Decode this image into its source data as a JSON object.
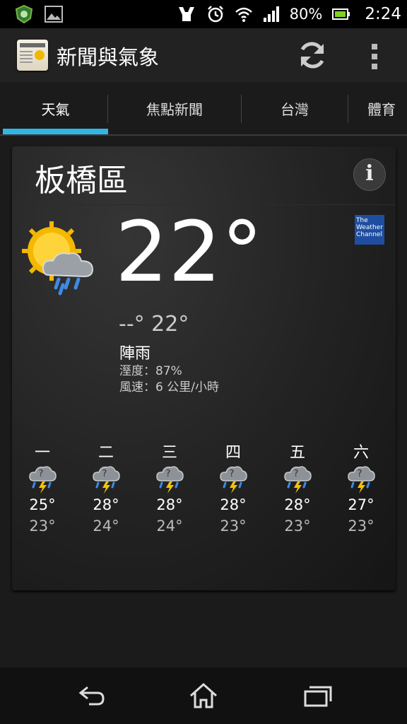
{
  "status_bar": {
    "battery": "80%",
    "time": "2:24",
    "icons": [
      "shield-icon",
      "image-icon",
      "accessory-icon",
      "alarm-icon",
      "wifi-icon",
      "signal-icon",
      "battery-icon"
    ]
  },
  "action_bar": {
    "title": "新聞與氣象",
    "icons": [
      "app-newspaper-icon",
      "refresh-icon",
      "overflow-menu-icon"
    ]
  },
  "tabs": [
    {
      "label": "天氣",
      "selected": true
    },
    {
      "label": "焦點新聞",
      "selected": false
    },
    {
      "label": "台灣",
      "selected": false
    },
    {
      "label": "體育",
      "selected": false
    }
  ],
  "colors": {
    "accent": "#33b5e5",
    "background": "#1b1b1b"
  },
  "weather": {
    "location": "板橋區",
    "temperature": "22°",
    "hi_lo": "--°  22°",
    "condition": "陣雨",
    "humidity": "溼度：87%",
    "wind": "風速：6 公里/小時",
    "provider_logo": [
      "The",
      "Weather",
      "Channel"
    ],
    "icon": "sun-cloud-rain-icon"
  },
  "forecast": [
    {
      "day": "一",
      "high": "25°",
      "low": "23°",
      "icon": "thunderstorm-icon"
    },
    {
      "day": "二",
      "high": "28°",
      "low": "24°",
      "icon": "thunderstorm-icon"
    },
    {
      "day": "三",
      "high": "28°",
      "low": "24°",
      "icon": "thunderstorm-icon"
    },
    {
      "day": "四",
      "high": "28°",
      "low": "23°",
      "icon": "thunderstorm-icon"
    },
    {
      "day": "五",
      "high": "28°",
      "low": "23°",
      "icon": "thunderstorm-icon"
    },
    {
      "day": "六",
      "high": "27°",
      "low": "23°",
      "icon": "thunderstorm-icon"
    }
  ],
  "nav_bar": {
    "icons": [
      "back-icon",
      "home-icon",
      "recent-apps-icon"
    ]
  }
}
